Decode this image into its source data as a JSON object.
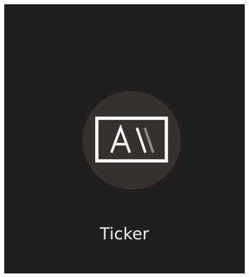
{
  "tile": {
    "label": "Ticker",
    "icon": "ticker-icon"
  },
  "colors": {
    "tile_background": "#221f1f",
    "circle_background": "#34312f",
    "icon_stroke": "#ffffff",
    "icon_slash_faded": "#8c8987",
    "label_text": "#f2f2f2"
  }
}
